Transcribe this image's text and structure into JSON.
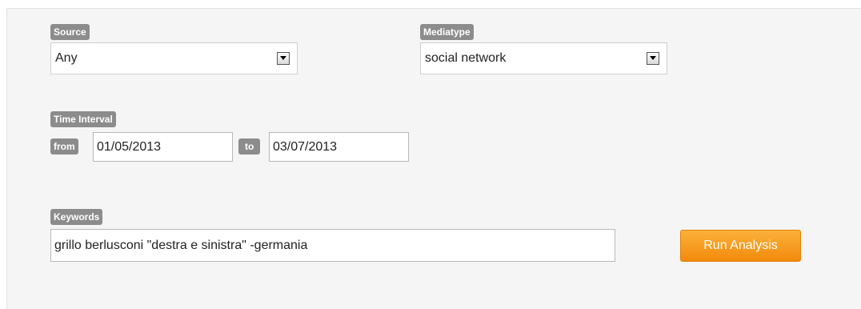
{
  "source": {
    "label": "Source",
    "value": "Any"
  },
  "mediatype": {
    "label": "Mediatype",
    "value": "social network"
  },
  "time_interval": {
    "label": "Time Interval",
    "from_label": "from",
    "from_value": "01/05/2013",
    "to_label": "to",
    "to_value": "03/07/2013"
  },
  "keywords": {
    "label": "Keywords",
    "value": "grillo berlusconi \"destra e sinistra\" -germania"
  },
  "run_button": {
    "label": "Run Analysis"
  }
}
